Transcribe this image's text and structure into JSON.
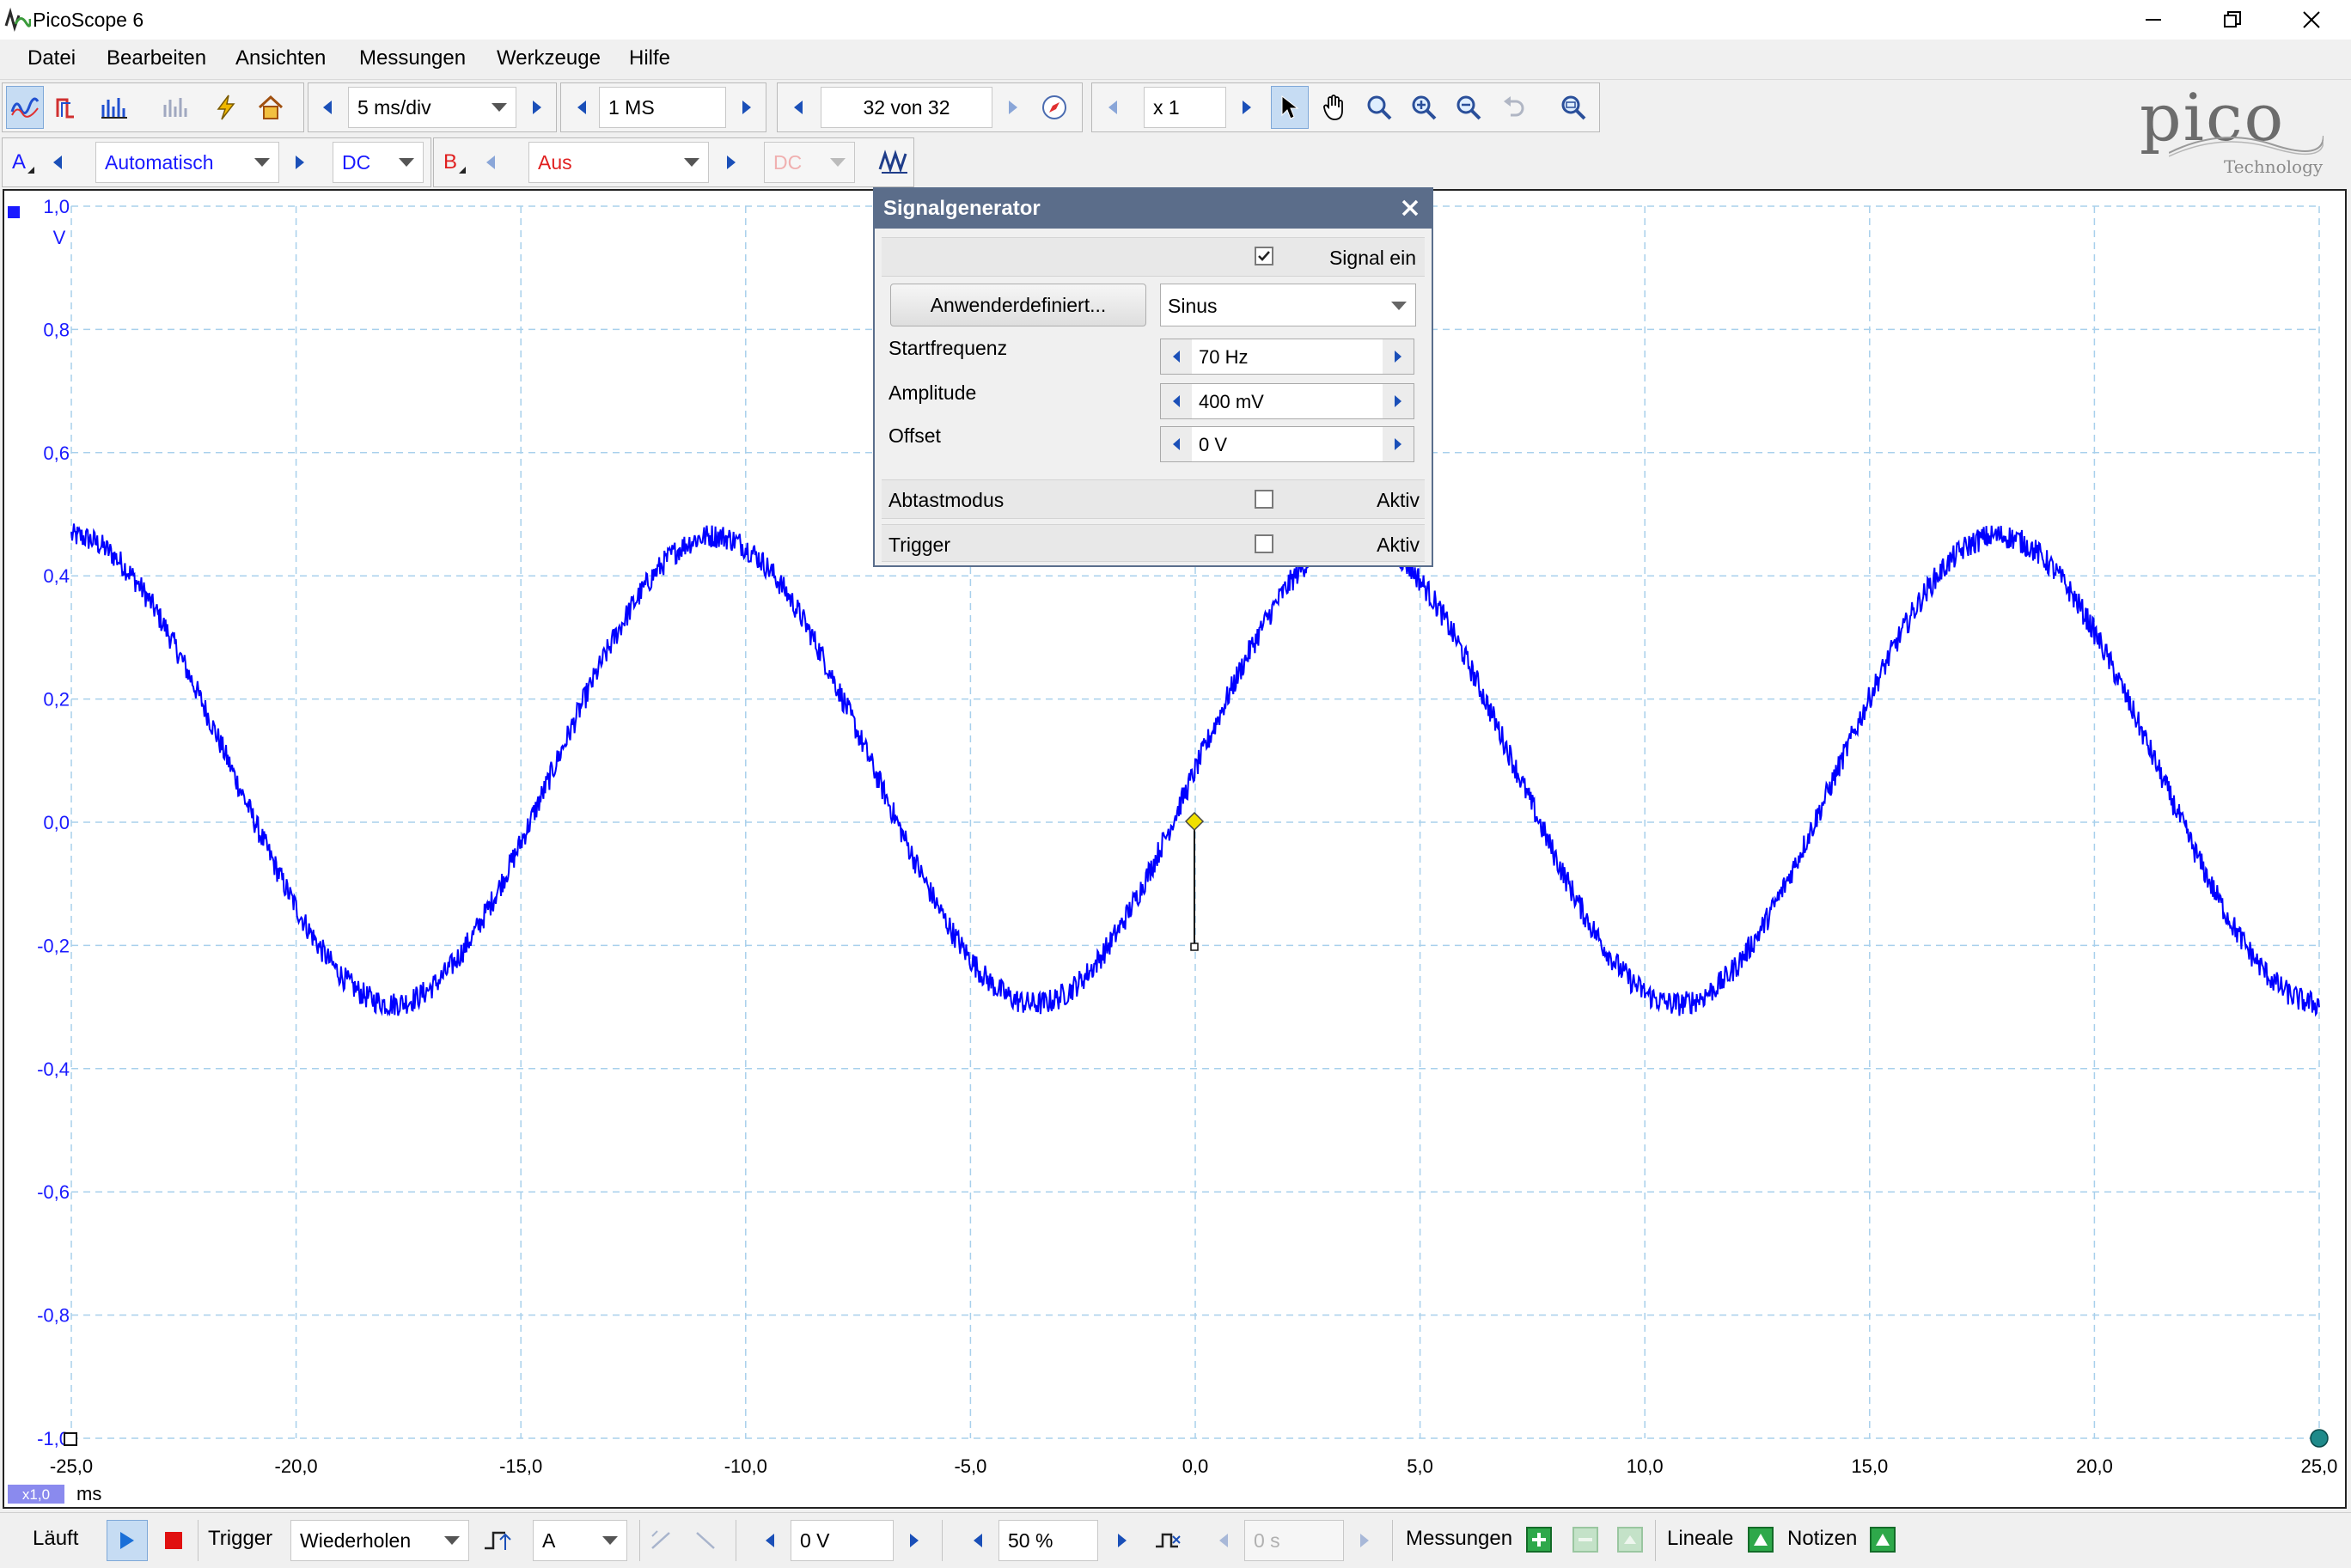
{
  "window": {
    "title": "PicoScope 6"
  },
  "menu": {
    "items": [
      "Datei",
      "Bearbeiten",
      "Ansichten",
      "Messungen",
      "Werkzeuge",
      "Hilfe"
    ]
  },
  "toolbar": {
    "timebase": "5 ms/div",
    "samples": "1 MS",
    "buffer": "32 von 32",
    "zoom": "x 1"
  },
  "channels": {
    "a": {
      "letter": "A",
      "range": "Automatisch",
      "coupling": "DC",
      "color": "#1a1aff"
    },
    "b": {
      "letter": "B",
      "range": "Aus",
      "coupling": "DC",
      "color": "#e02020"
    }
  },
  "logo": {
    "brand": "pico",
    "sub": "Technology"
  },
  "plot": {
    "unit_y": "V",
    "unit_x": "ms",
    "x_scale_tag": "x1,0",
    "y_ticks": [
      "1,0",
      "0,8",
      "0,6",
      "0,4",
      "0,2",
      "0,0",
      "-0,2",
      "-0,4",
      "-0,6",
      "-0,8",
      "-1,0"
    ],
    "x_ticks": [
      "-25,0",
      "-20,0",
      "-15,0",
      "-10,0",
      "-5,0",
      "0,0",
      "5,0",
      "10,0",
      "15,0",
      "20,0",
      "25,0"
    ],
    "trace_color": "#0000ff"
  },
  "chart_data": {
    "type": "line",
    "xlabel": "ms",
    "ylabel": "V",
    "xlim": [
      -25,
      25
    ],
    "ylim": [
      -1,
      1
    ],
    "grid": true,
    "series": [
      {
        "waveform": "sine",
        "frequency_hz": 70,
        "amplitude_v": 0.38,
        "offset_v": 0.085,
        "phase_zero_crossing_ms": 0,
        "noise_v": 0.02
      }
    ]
  },
  "siggen": {
    "title": "Signalgenerator",
    "signal_on_label": "Signal ein",
    "signal_on": true,
    "custom_button": "Anwenderdefiniert...",
    "waveform": "Sinus",
    "start_freq_label": "Startfrequenz",
    "start_freq": "70 Hz",
    "amplitude_label": "Amplitude",
    "amplitude": "400 mV",
    "offset_label": "Offset",
    "offset": "0 V",
    "sweep_label": "Abtastmodus",
    "sweep_active_label": "Aktiv",
    "trigger_label": "Trigger",
    "trigger_active_label": "Aktiv"
  },
  "status": {
    "running": "Läuft",
    "trigger_label": "Trigger",
    "trigger_mode": "Wiederholen",
    "trigger_channel": "A",
    "threshold": "0 V",
    "pretrigger": "50 %",
    "delay": "0 s",
    "measurements": "Messungen",
    "rulers": "Lineale",
    "notes": "Notizen"
  }
}
